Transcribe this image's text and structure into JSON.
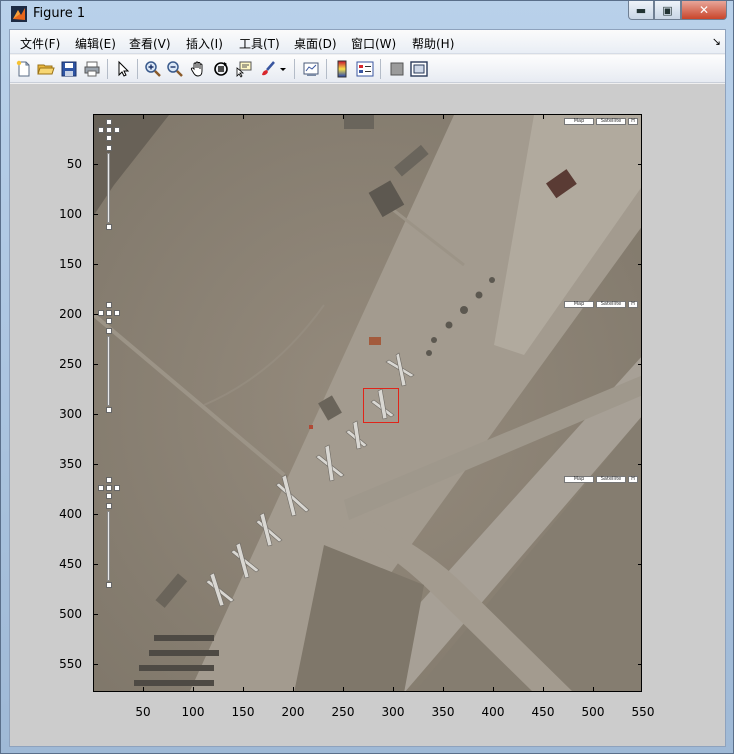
{
  "window": {
    "title": "Figure 1",
    "minimize_glyph": "▬",
    "maximize_glyph": "▣",
    "close_glyph": "✕"
  },
  "menubar": {
    "items": [
      {
        "label": "文件(F)"
      },
      {
        "label": "编辑(E)"
      },
      {
        "label": "查看(V)"
      },
      {
        "label": "插入(I)"
      },
      {
        "label": "工具(T)"
      },
      {
        "label": "桌面(D)"
      },
      {
        "label": "窗口(W)"
      },
      {
        "label": "帮助(H)"
      }
    ],
    "overflow_glyph": "↘"
  },
  "toolbar": {
    "icons": [
      "new-figure-icon",
      "open-file-icon",
      "save-icon",
      "print-icon",
      "edit-plot-arrow-icon",
      "zoom-in-icon",
      "zoom-out-icon",
      "pan-hand-icon",
      "rotate-3d-icon",
      "data-cursor-icon",
      "brush-icon",
      "brush-dropdown-icon",
      "link-plot-icon",
      "colorbar-icon",
      "legend-icon",
      "hide-plot-tools-icon",
      "show-plot-tools-icon"
    ]
  },
  "axes": {
    "yticks": [
      "50",
      "100",
      "150",
      "200",
      "250",
      "300",
      "350",
      "400",
      "450",
      "500",
      "550"
    ],
    "xticks": [
      "50",
      "100",
      "150",
      "200",
      "250",
      "300",
      "350",
      "400",
      "450",
      "500",
      "550"
    ]
  },
  "map_overlay": {
    "buttons": [
      "Map",
      "Satellite",
      "H"
    ]
  },
  "colors": {
    "selection_box": "#e0251a",
    "terrain": "#8b8376",
    "runway": "#a7a096"
  }
}
